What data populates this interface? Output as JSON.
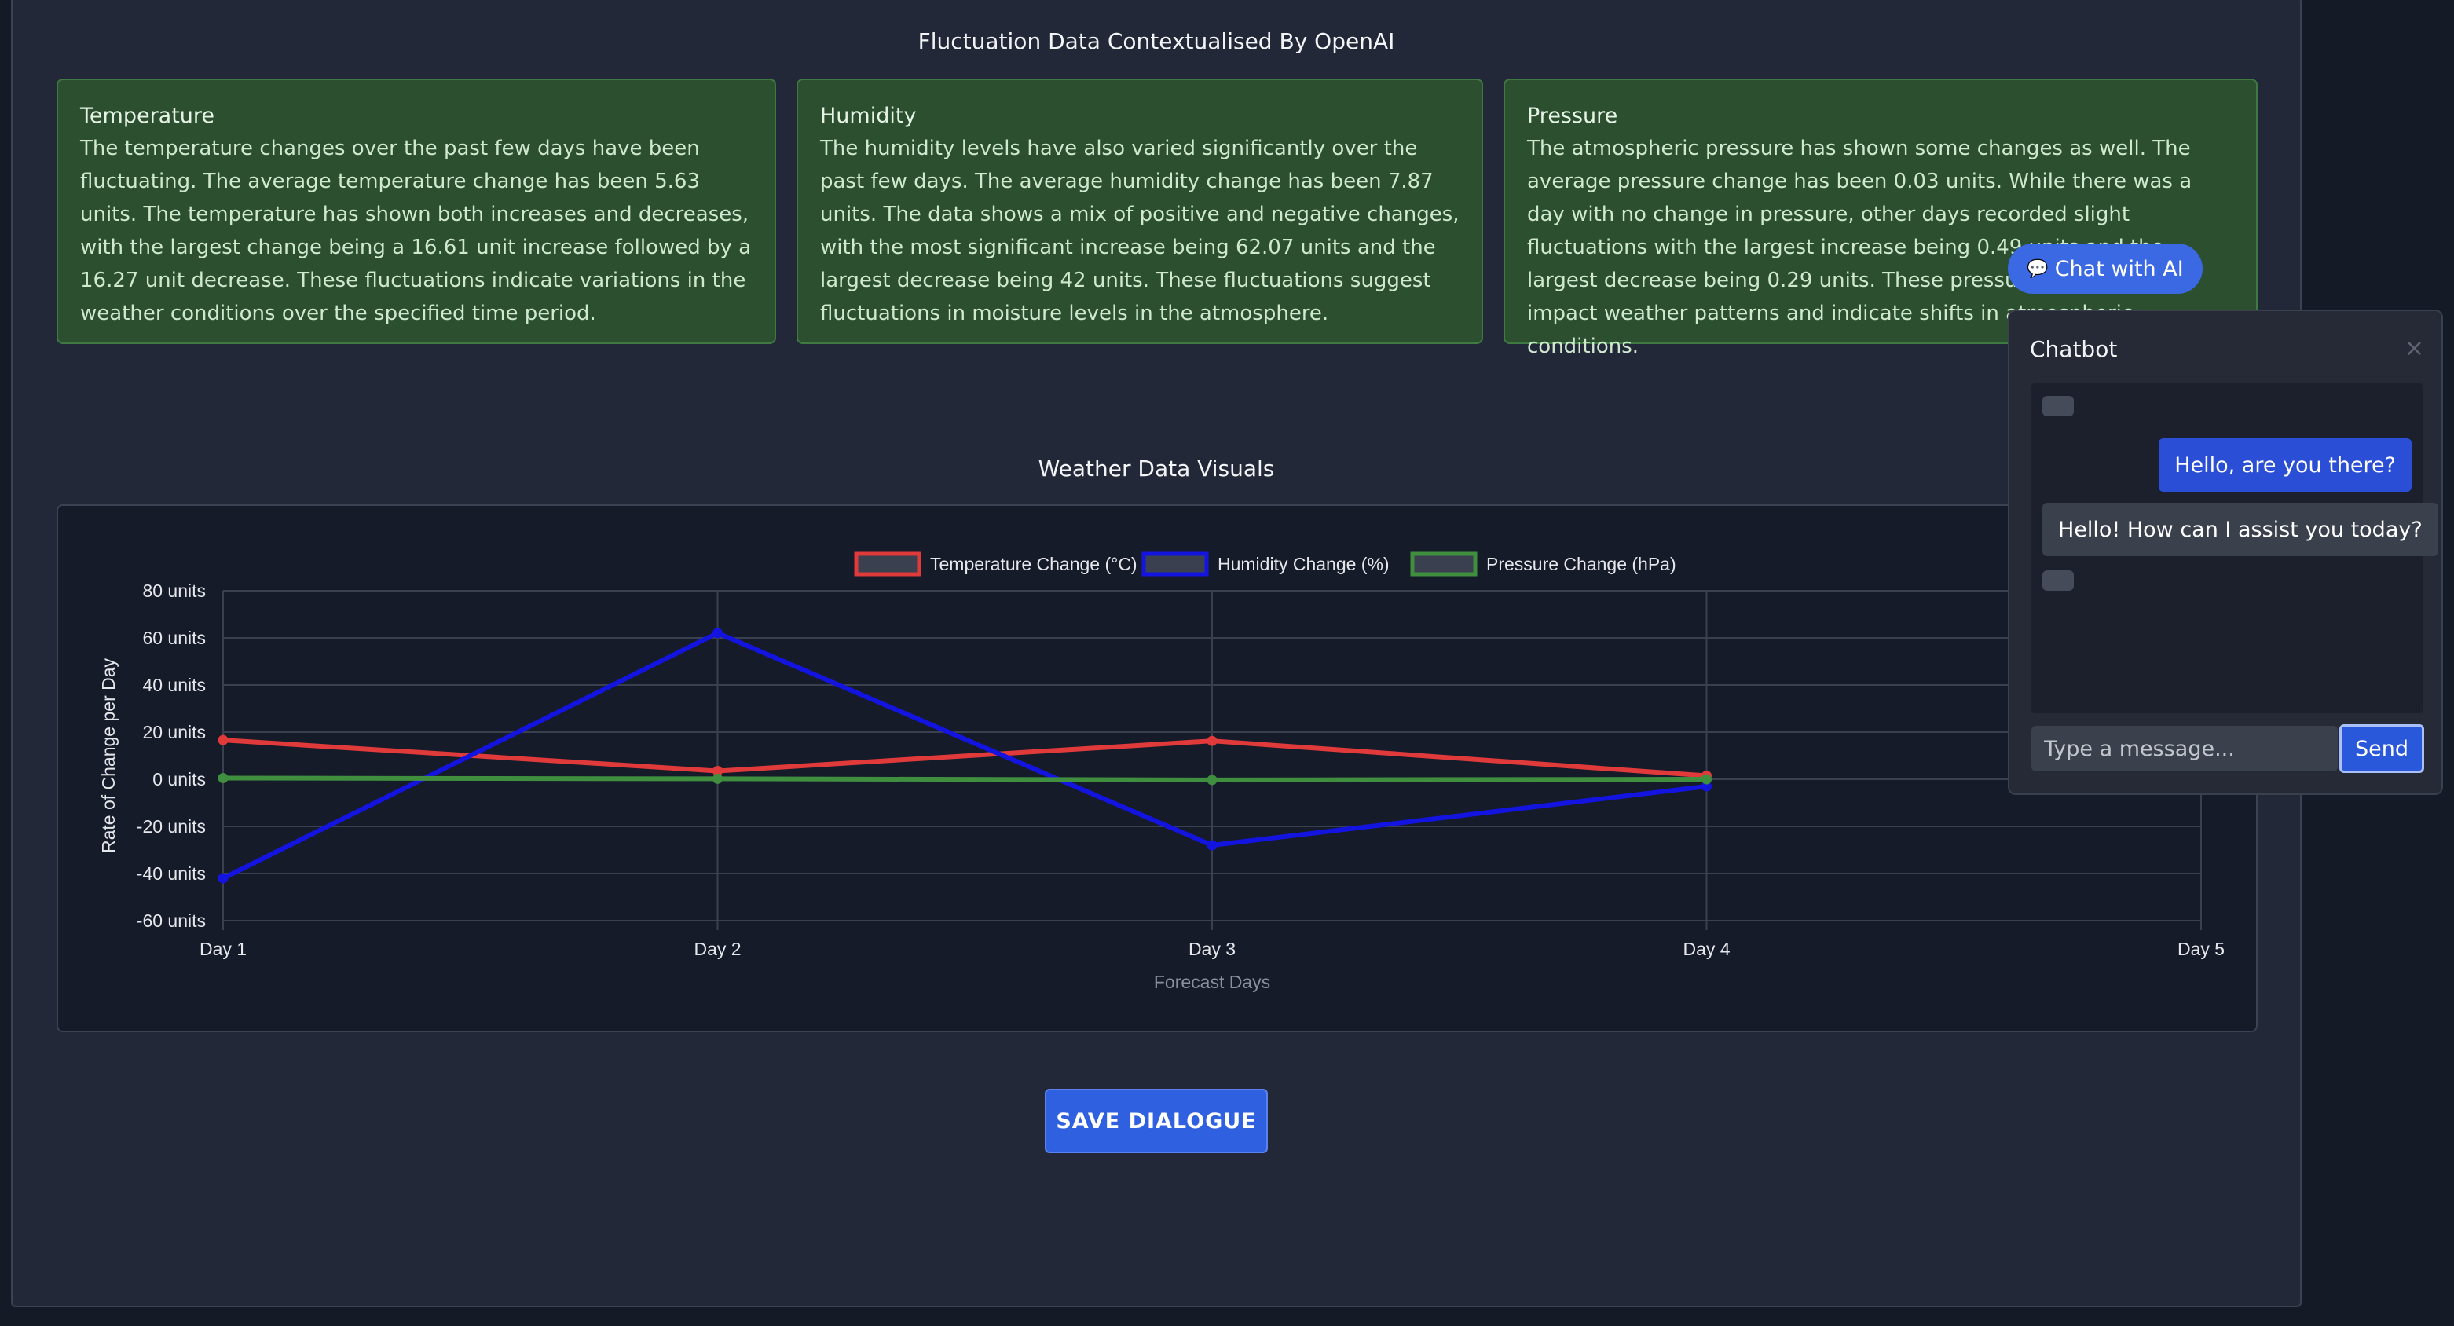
{
  "header": {
    "title": "Fluctuation Data Contextualised By OpenAI"
  },
  "cards": [
    {
      "heading": "Temperature",
      "body": "The temperature changes over the past few days have been fluctuating. The average temperature change has been 5.63 units. The temperature has shown both increases and decreases, with the largest change being a 16.61 unit increase followed by a 16.27 unit decrease. These fluctuations indicate variations in the weather conditions over the specified time period."
    },
    {
      "heading": "Humidity",
      "body": "The humidity levels have also varied significantly over the past few days. The average humidity change has been 7.87 units. The data shows a mix of positive and negative changes, with the most significant increase being 62.07 units and the largest decrease being 42 units. These fluctuations suggest fluctuations in moisture levels in the atmosphere."
    },
    {
      "heading": "Pressure",
      "body": "The atmospheric pressure has shown some changes as well. The average pressure change has been 0.03 units. While there was a day with no change in pressure, other days recorded slight fluctuations with the largest increase being 0.49 units and the largest decrease being 0.29 units. These pressure variations can impact weather patterns and indicate shifts in atmospheric conditions."
    }
  ],
  "visuals": {
    "title": "Weather Data Visuals"
  },
  "chart_data": {
    "type": "line",
    "categories": [
      "Day 1",
      "Day 2",
      "Day 3",
      "Day 4",
      "Day 5"
    ],
    "series": [
      {
        "name": "Temperature Change (°C)",
        "color": "#e03a3a",
        "values": [
          16.61,
          3.5,
          16.27,
          1.5,
          null
        ]
      },
      {
        "name": "Humidity Change (%)",
        "color": "#1414e0",
        "values": [
          -42,
          62.07,
          -28,
          -3,
          null
        ]
      },
      {
        "name": "Pressure Change (hPa)",
        "color": "#3f8f3f",
        "values": [
          0.49,
          0.2,
          -0.29,
          0,
          null
        ]
      }
    ],
    "xlabel": "Forecast Days",
    "ylabel": "Rate of Change per Day",
    "ylim": [
      -60,
      80
    ],
    "yticks": [
      80,
      60,
      40,
      20,
      0,
      -20,
      -40,
      -60
    ],
    "ytick_suffix": " units",
    "grid": true,
    "legend": "top"
  },
  "actions": {
    "save_label": "SAVE DIALOGUE"
  },
  "chat_toggle": {
    "label": "Chat with AI",
    "icon": "speech-bubble-icon"
  },
  "chatbot": {
    "title": "Chatbot",
    "close_glyph": "×",
    "messages": [
      {
        "role": "user",
        "text": "Hello, are you there?"
      },
      {
        "role": "bot",
        "text": "Hello! How can I assist you today?"
      }
    ],
    "input_placeholder": "Type a message...",
    "send_label": "Send"
  }
}
